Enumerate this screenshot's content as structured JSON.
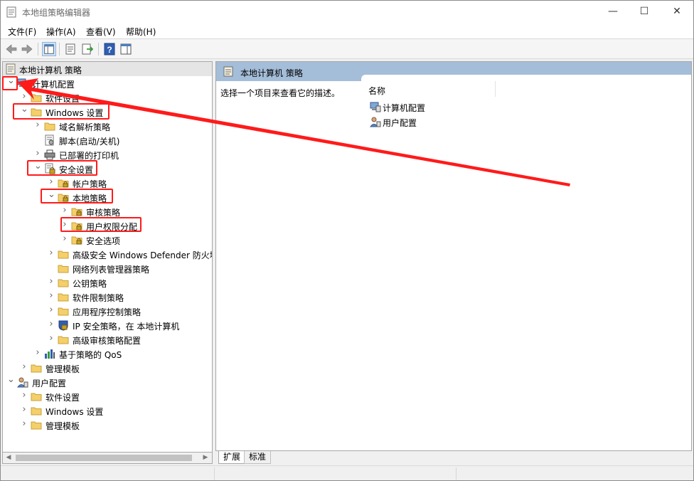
{
  "window": {
    "title": "本地组策略编辑器",
    "minimize": "—",
    "maximize": "☐",
    "close": "✕"
  },
  "menu": [
    {
      "label": "文件(F)"
    },
    {
      "label": "操作(A)"
    },
    {
      "label": "查看(V)"
    },
    {
      "label": "帮助(H)"
    }
  ],
  "toolbar": {
    "buttons": [
      "back-icon",
      "forward-icon",
      "show-hide-tree-icon",
      "properties-icon",
      "export-list-icon",
      "help-icon",
      "show-action-pane-icon"
    ]
  },
  "tree": {
    "root": "本地计算机 策略",
    "items": [
      {
        "label": "计算机配置",
        "expand": "open",
        "icon": "computer-config-icon"
      },
      {
        "label": "软件设置",
        "expand": "closed",
        "icon": "folder-icon"
      },
      {
        "label": "Windows 设置",
        "expand": "open",
        "icon": "folder-icon"
      },
      {
        "label": "域名解析策略",
        "expand": "closed",
        "icon": "folder-icon"
      },
      {
        "label": "脚本(启动/关机)",
        "expand": "none",
        "icon": "script-icon"
      },
      {
        "label": "已部署的打印机",
        "expand": "closed",
        "icon": "printer-icon"
      },
      {
        "label": "安全设置",
        "expand": "open",
        "icon": "security-settings-icon"
      },
      {
        "label": "帐户策略",
        "expand": "closed",
        "icon": "locked-folder-icon"
      },
      {
        "label": "本地策略",
        "expand": "open",
        "icon": "locked-folder-icon"
      },
      {
        "label": "审核策略",
        "expand": "closed",
        "icon": "locked-folder-icon"
      },
      {
        "label": "用户权限分配",
        "expand": "closed",
        "icon": "locked-folder-icon"
      },
      {
        "label": "安全选项",
        "expand": "closed",
        "icon": "locked-folder-icon"
      },
      {
        "label": "高级安全 Windows Defender 防火墙",
        "expand": "closed",
        "icon": "folder-icon"
      },
      {
        "label": "网络列表管理器策略",
        "expand": "none",
        "icon": "folder-icon"
      },
      {
        "label": "公钥策略",
        "expand": "closed",
        "icon": "folder-icon"
      },
      {
        "label": "软件限制策略",
        "expand": "closed",
        "icon": "folder-icon"
      },
      {
        "label": "应用程序控制策略",
        "expand": "closed",
        "icon": "folder-icon"
      },
      {
        "label": "IP 安全策略，在 本地计算机",
        "expand": "closed",
        "icon": "ip-security-icon"
      },
      {
        "label": "高级审核策略配置",
        "expand": "closed",
        "icon": "folder-icon"
      },
      {
        "label": "基于策略的 QoS",
        "expand": "closed",
        "icon": "qos-chart-icon"
      },
      {
        "label": "管理模板",
        "expand": "closed",
        "icon": "folder-icon"
      },
      {
        "label": "用户配置",
        "expand": "open",
        "icon": "user-config-icon"
      },
      {
        "label": "软件设置",
        "expand": "closed",
        "icon": "folder-icon"
      },
      {
        "label": "Windows 设置",
        "expand": "closed",
        "icon": "folder-icon"
      },
      {
        "label": "管理模板",
        "expand": "closed",
        "icon": "folder-icon"
      }
    ]
  },
  "content": {
    "header_title": "本地计算机 策略",
    "description": "选择一个项目来查看它的描述。",
    "column_name": "名称",
    "items": [
      {
        "label": "计算机配置",
        "icon": "computer-config-icon"
      },
      {
        "label": "用户配置",
        "icon": "user-config-icon"
      }
    ]
  },
  "tabs": [
    {
      "label": "扩展",
      "active": true
    },
    {
      "label": "标准",
      "active": false
    }
  ],
  "colors": {
    "annotation_red": "#ff1a1a",
    "header_blue": "#a4bdd8",
    "folder_yellow": "#f4cf6a"
  }
}
